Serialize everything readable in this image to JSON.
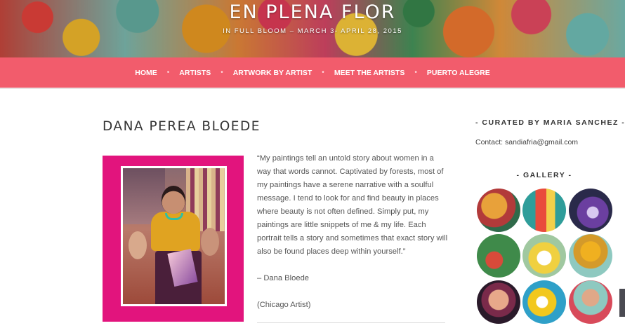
{
  "header": {
    "title": "EN PLENA FLOR",
    "subtitle": "IN FULL BLOOM – MARCH 3- APRIL 28, 2015"
  },
  "nav": {
    "items": [
      "HOME",
      "ARTISTS",
      "ARTWORK BY ARTIST",
      "MEET THE ARTISTS",
      "PUERTO ALEGRE"
    ],
    "separator": "•"
  },
  "post": {
    "title": "DANA PEREA BLOEDE",
    "quote": "“My paintings tell an untold story about women in a way that words cannot. Captivated by forests, most of my paintings have a serene narrative with a soulful message. I tend to look for and find beauty in places where beauty is not often defined. Simply put, my paintings are little snippets of me & my life. Each portrait tells a story and sometimes that exact story will also be found places deep within yourself.”",
    "attribution": "– Dana Bloede",
    "location": "(Chicago Artist)"
  },
  "sidebar": {
    "curator_title": "- CURATED BY MARIA SANCHEZ -",
    "contact": "Contact: sandiafria@gmail.com",
    "gallery_title": "- GALLERY -"
  },
  "colors": {
    "nav_background": "#f25c6c",
    "photo_frame": "#e2147d",
    "gallery_thumbs": [
      "#b23a3a",
      "#2f9d9a",
      "#6b3fa0",
      "#3f8a4a",
      "#f0d040",
      "#d49a2a",
      "#7a2a4a",
      "#f2c81e",
      "#8ec9c0"
    ]
  }
}
